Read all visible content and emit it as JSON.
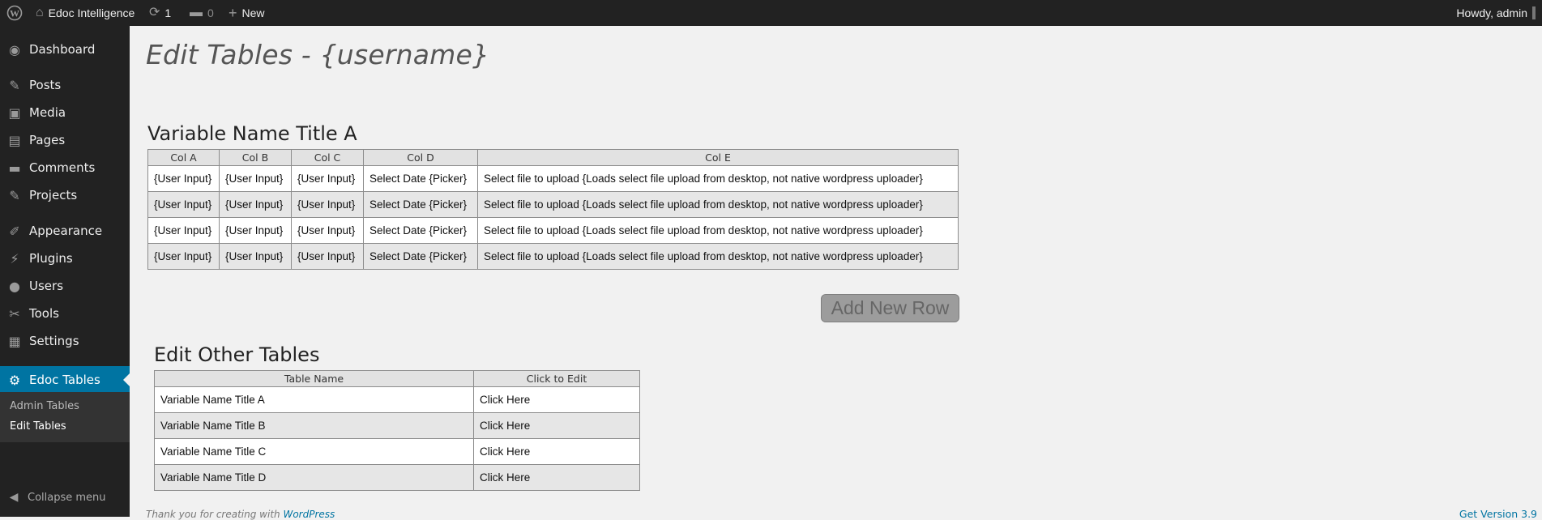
{
  "adminbar": {
    "site_name": "Edoc Intelligence",
    "updates_count": "1",
    "comments_count": "0",
    "new_label": "New",
    "howdy": "Howdy, admin"
  },
  "sidebar": {
    "items": [
      {
        "label": "Dashboard",
        "icon": "dashboard-icon"
      },
      {
        "label": "Posts",
        "icon": "pin-icon"
      },
      {
        "label": "Media",
        "icon": "media-icon"
      },
      {
        "label": "Pages",
        "icon": "pages-icon"
      },
      {
        "label": "Comments",
        "icon": "comment-icon"
      },
      {
        "label": "Projects",
        "icon": "pin-icon"
      },
      {
        "label": "Appearance",
        "icon": "brush-icon"
      },
      {
        "label": "Plugins",
        "icon": "plug-icon"
      },
      {
        "label": "Users",
        "icon": "user-icon"
      },
      {
        "label": "Tools",
        "icon": "wrench-icon"
      },
      {
        "label": "Settings",
        "icon": "settings-icon"
      },
      {
        "label": "Edoc Tables",
        "icon": "gear-icon"
      }
    ],
    "submenu": [
      "Admin Tables",
      "Edit Tables"
    ],
    "collapse_label": "Collapse menu"
  },
  "page_title": "Edit Tables - {username}",
  "table_a": {
    "title": "Variable Name Title A",
    "columns": [
      "Col A",
      "Col B",
      "Col C",
      "Col D",
      "Col E"
    ],
    "rows": [
      [
        "{User Input}",
        "{User Input}",
        "{User Input}",
        "Select Date {Picker}",
        "Select file to upload {Loads select file upload from desktop, not native wordpress uploader}"
      ],
      [
        "{User Input}",
        "{User Input}",
        "{User Input}",
        "Select Date {Picker}",
        "Select file to upload {Loads select file upload from desktop, not native wordpress uploader}"
      ],
      [
        "{User Input}",
        "{User Input}",
        "{User Input}",
        "Select Date {Picker}",
        "Select file to upload {Loads select file upload from desktop, not native wordpress uploader}"
      ],
      [
        "{User Input}",
        "{User Input}",
        "{User Input}",
        "Select Date {Picker}",
        "Select file to upload {Loads select file upload from desktop, not native wordpress uploader}"
      ]
    ],
    "add_row_label": "Add New Row"
  },
  "other_tables": {
    "title": "Edit Other Tables",
    "columns": [
      "Table Name",
      "Click to Edit"
    ],
    "rows": [
      [
        "Variable Name Title A",
        "Click Here"
      ],
      [
        "Variable Name Title B",
        "Click Here"
      ],
      [
        "Variable Name Title C",
        "Click Here"
      ],
      [
        "Variable Name Title D",
        "Click Here"
      ]
    ]
  },
  "footer": {
    "thanks_text": "Thank you for creating with",
    "wp_link": "WordPress",
    "version_link": "Get Version 3.9"
  },
  "colors": {
    "adminbar_bg": "#222222",
    "active_menu": "#0074a2",
    "content_bg": "#f1f1f1"
  }
}
